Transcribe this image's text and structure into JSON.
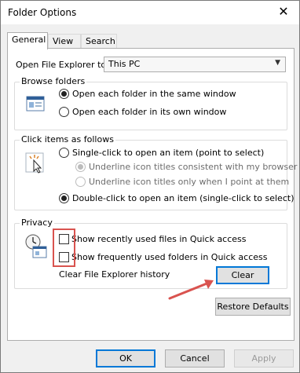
{
  "window": {
    "title": "Folder Options",
    "close_glyph": "✕"
  },
  "tabs": [
    {
      "label": "General",
      "active": true
    },
    {
      "label": "View",
      "active": false
    },
    {
      "label": "Search",
      "active": false
    }
  ],
  "open_explorer": {
    "label": "Open File Explorer to:",
    "value": "This PC",
    "arrow": "▼"
  },
  "browse": {
    "title": "Browse folders",
    "options": [
      {
        "label": "Open each folder in the same window",
        "selected": true
      },
      {
        "label": "Open each folder in its own window",
        "selected": false
      }
    ]
  },
  "click_items": {
    "title": "Click items as follows",
    "single": "Single-click to open an item (point to select)",
    "underline_browser": "Underline icon titles consistent with my browser",
    "underline_point": "Underline icon titles only when I point at them",
    "double": "Double-click to open an item (single-click to select)"
  },
  "privacy": {
    "title": "Privacy",
    "recent_files": "Show recently used files in Quick access",
    "frequent_folders": "Show frequently used folders in Quick access",
    "clear_history": "Clear File Explorer history",
    "clear_button": "Clear"
  },
  "restore_defaults": "Restore Defaults",
  "footer": {
    "ok": "OK",
    "cancel": "Cancel",
    "apply": "Apply"
  },
  "annotation_color": "#d9534f"
}
